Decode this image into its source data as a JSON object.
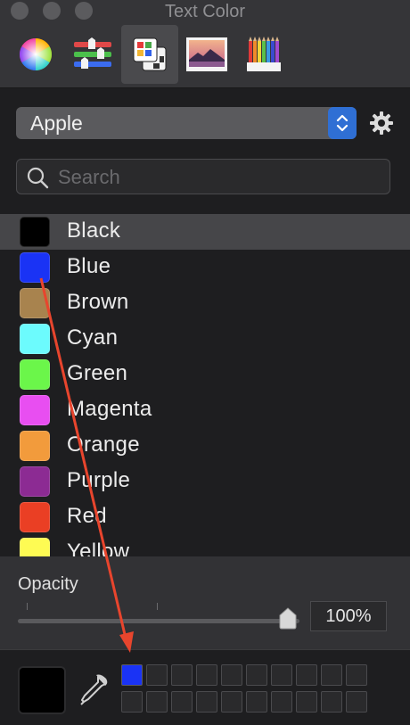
{
  "window": {
    "title": "Text Color"
  },
  "toolbar": {
    "tools": [
      {
        "icon": "color-wheel-icon"
      },
      {
        "icon": "color-sliders-icon"
      },
      {
        "icon": "color-palettes-icon",
        "selected": true
      },
      {
        "icon": "image-palettes-icon"
      },
      {
        "icon": "pencils-icon"
      }
    ]
  },
  "palette": {
    "selected": "Apple"
  },
  "search": {
    "placeholder": "Search",
    "value": ""
  },
  "colors": [
    {
      "name": "Black",
      "hex": "#000000",
      "selected": true
    },
    {
      "name": "Blue",
      "hex": "#1a33f5"
    },
    {
      "name": "Brown",
      "hex": "#a8834e"
    },
    {
      "name": "Cyan",
      "hex": "#6cfbfd"
    },
    {
      "name": "Green",
      "hex": "#6bf64a"
    },
    {
      "name": "Magenta",
      "hex": "#e84ef1"
    },
    {
      "name": "Orange",
      "hex": "#f29b3c"
    },
    {
      "name": "Purple",
      "hex": "#8c2b93"
    },
    {
      "name": "Red",
      "hex": "#ea3f24"
    },
    {
      "name": "Yellow",
      "hex": "#fefb53"
    }
  ],
  "opacity": {
    "label": "Opacity",
    "value_text": "100%",
    "value": 1.0
  },
  "current_color": {
    "hex": "#000000"
  },
  "saved_swatches": {
    "first": "#1a33f5"
  },
  "annotation": {
    "arrow_color": "#e8452d"
  }
}
